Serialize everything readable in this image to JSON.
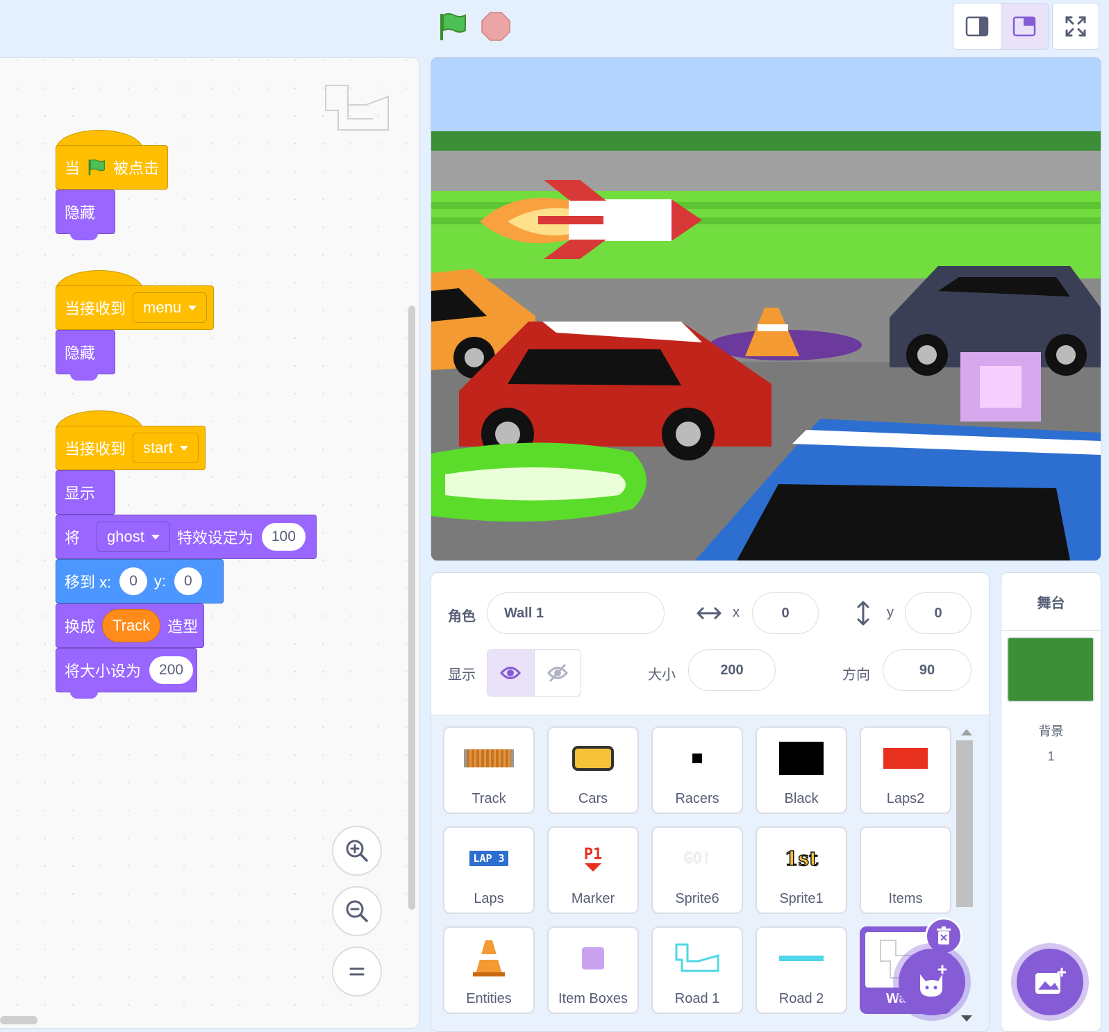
{
  "toolbar": {
    "green_flag_icon": "green-flag-icon",
    "stop_icon": "stop-icon",
    "accent_color": "#855cd6"
  },
  "scripts": {
    "script1": {
      "hat_when": "当",
      "hat_clicked": "被点击",
      "block1": "隐藏"
    },
    "script2": {
      "hat_label": "当接收到",
      "message": "menu",
      "block1": "隐藏"
    },
    "script3": {
      "hat_label": "当接收到",
      "message": "start",
      "show": "显示",
      "effect_prefix": "将",
      "effect_name": "ghost",
      "effect_mid": "特效设定为",
      "effect_value": "100",
      "goto_label": "移到 x:",
      "goto_x": "0",
      "goto_y_label": "y:",
      "goto_y": "0",
      "switch_prefix": "换成",
      "costume": "Track",
      "switch_suffix": "造型",
      "size_label": "将大小设为",
      "size_value": "200"
    }
  },
  "sprite_info": {
    "sprite_label": "角色",
    "sprite_name": "Wall 1",
    "x_label": "x",
    "x_value": "0",
    "y_label": "y",
    "y_value": "0",
    "show_label": "显示",
    "size_label": "大小",
    "size_value": "200",
    "direction_label": "方向",
    "direction_value": "90"
  },
  "sprites": [
    {
      "name": "Track"
    },
    {
      "name": "Cars"
    },
    {
      "name": "Racers"
    },
    {
      "name": "Black"
    },
    {
      "name": "Laps2"
    },
    {
      "name": "Laps",
      "thumb_text": "LAP 3"
    },
    {
      "name": "Marker",
      "thumb_text": "P1"
    },
    {
      "name": "Sprite6",
      "thumb_text": "GO!"
    },
    {
      "name": "Sprite1",
      "thumb_text": "1st"
    },
    {
      "name": "Items"
    },
    {
      "name": "Entities"
    },
    {
      "name": "Item Boxes"
    },
    {
      "name": "Road 1"
    },
    {
      "name": "Road 2"
    },
    {
      "name": "Wa"
    }
  ],
  "stage_panel": {
    "title": "舞台",
    "backdrop_label": "背景",
    "backdrop_count": "1",
    "backdrop_color": "#3c8f36"
  }
}
